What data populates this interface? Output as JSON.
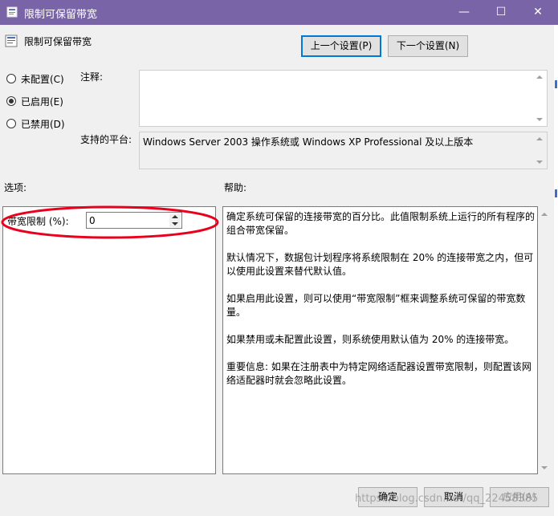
{
  "window": {
    "title": "限制可保留带宽",
    "minimize": "—",
    "maximize": "☐",
    "close": "✕"
  },
  "header": {
    "title": "限制可保留带宽",
    "prev_button": "上一个设置(P)",
    "next_button": "下一个设置(N)"
  },
  "state": {
    "options": [
      {
        "label": "未配置(C)",
        "selected": false
      },
      {
        "label": "已启用(E)",
        "selected": true
      },
      {
        "label": "已禁用(D)",
        "selected": false
      }
    ]
  },
  "comment": {
    "label": "注释:",
    "value": ""
  },
  "platform": {
    "label": "支持的平台:",
    "value": "Windows Server 2003 操作系统或 Windows XP Professional 及以上版本"
  },
  "options_section": {
    "label": "选项:",
    "bandwidth_label": "带宽限制 (%):",
    "bandwidth_value": "0"
  },
  "help": {
    "label": "帮助:",
    "paragraphs": [
      "确定系统可保留的连接带宽的百分比。此值限制系统上运行的所有程序的组合带宽保留。",
      "默认情况下，数据包计划程序将系统限制在 20% 的连接带宽之内，但可以使用此设置来替代默认值。",
      "如果启用此设置，则可以使用“带宽限制”框来调整系统可保留的带宽数量。",
      "如果禁用或未配置此设置，则系统使用默认值为 20% 的连接带宽。",
      "重要信息: 如果在注册表中为特定网络适配器设置带宽限制，则配置该网络适配器时就会忽略此设置。"
    ]
  },
  "footer": {
    "ok": "确定",
    "cancel": "取消",
    "apply": "应用(A)",
    "watermark": "https://blog.csdn.net/qq_22458385"
  },
  "colors": {
    "titlebar": "#7a64a8",
    "annotation": "#e8001c",
    "focus": "#0078d7"
  }
}
